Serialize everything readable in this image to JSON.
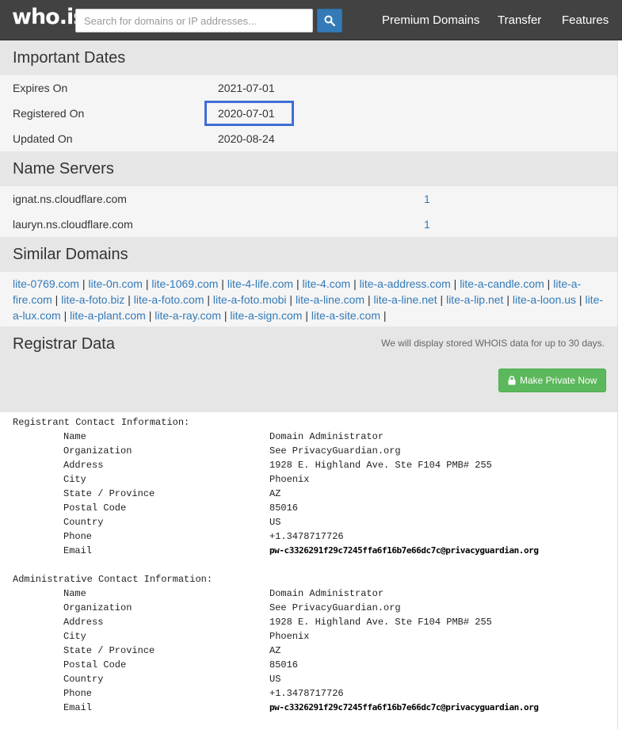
{
  "header": {
    "logo": "who.is",
    "search_placeholder": "Search for domains or IP addresses...",
    "nav": [
      "Premium Domains",
      "Transfer",
      "Features"
    ]
  },
  "important_dates": {
    "title": "Important Dates",
    "rows": [
      {
        "label": "Expires On",
        "value": "2021-07-01"
      },
      {
        "label": "Registered On",
        "value": "2020-07-01"
      },
      {
        "label": "Updated On",
        "value": "2020-08-24"
      }
    ]
  },
  "name_servers": {
    "title": "Name Servers",
    "rows": [
      {
        "host": "ignat.ns.cloudflare.com",
        "count": "1"
      },
      {
        "host": "lauryn.ns.cloudflare.com",
        "count": "1"
      }
    ]
  },
  "similar_domains": {
    "title": "Similar Domains",
    "items": [
      "lite-0769.com",
      "lite-0n.com",
      "lite-1069.com",
      "lite-4-life.com",
      "lite-4.com",
      "lite-a-address.com",
      "lite-a-candle.com",
      "lite-a-fire.com",
      "lite-a-foto.biz",
      "lite-a-foto.com",
      "lite-a-foto.mobi",
      "lite-a-line.com",
      "lite-a-line.net",
      "lite-a-lip.net",
      "lite-a-loon.us",
      "lite-a-lux.com",
      "lite-a-plant.com",
      "lite-a-ray.com",
      "lite-a-sign.com",
      "lite-a-site.com"
    ]
  },
  "registrar": {
    "title": "Registrar Data",
    "note": "We will display stored WHOIS data for up to 30 days.",
    "private_button": "Make Private Now",
    "registrant": {
      "title": "Registrant Contact Information:",
      "fields": [
        {
          "k": "Name",
          "v": "Domain Administrator"
        },
        {
          "k": "Organization",
          "v": "See PrivacyGuardian.org"
        },
        {
          "k": "Address",
          "v": "1928 E. Highland Ave. Ste F104 PMB# 255"
        },
        {
          "k": "City",
          "v": "Phoenix"
        },
        {
          "k": "State / Province",
          "v": "AZ"
        },
        {
          "k": "Postal Code",
          "v": "85016"
        },
        {
          "k": "Country",
          "v": "US"
        },
        {
          "k": "Phone",
          "v": "+1.3478717726"
        },
        {
          "k": "Email",
          "v": "pw-c3326291f29c7245ffa6f16b7e66dc7c@privacyguardian.org"
        }
      ]
    },
    "administrative": {
      "title": "Administrative Contact Information:",
      "fields": [
        {
          "k": "Name",
          "v": "Domain Administrator"
        },
        {
          "k": "Organization",
          "v": "See PrivacyGuardian.org"
        },
        {
          "k": "Address",
          "v": "1928 E. Highland Ave. Ste F104 PMB# 255"
        },
        {
          "k": "City",
          "v": "Phoenix"
        },
        {
          "k": "State / Province",
          "v": "AZ"
        },
        {
          "k": "Postal Code",
          "v": "85016"
        },
        {
          "k": "Country",
          "v": "US"
        },
        {
          "k": "Phone",
          "v": "+1.3478717726"
        },
        {
          "k": "Email",
          "v": "pw-c3326291f29c7245ffa6f16b7e66dc7c@privacyguardian.org"
        }
      ]
    }
  },
  "colors": {
    "topbar": "#424242",
    "link": "#337ab7",
    "section_bg": "#e6e6e6",
    "row_bg": "#f5f5f5",
    "button_green": "#5cb85c",
    "highlight": "#3d6fd6"
  }
}
